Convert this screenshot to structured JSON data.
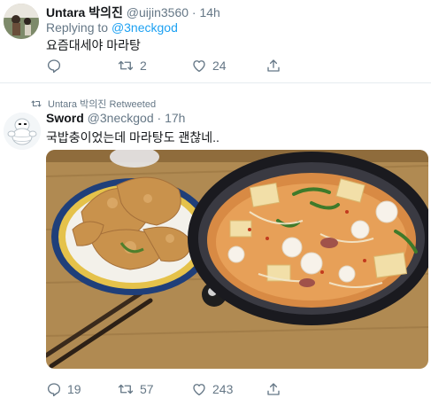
{
  "tweet1": {
    "display_name": "Untara 박의진",
    "handle": "@uijin3560",
    "separator": "·",
    "time": "14h",
    "replying_prefix": "Replying to",
    "replying_to": "@3neckgod",
    "text": "요즘대세야 마라탕",
    "reply_count": "",
    "retweet_count": "2",
    "like_count": "24"
  },
  "retweet_context": {
    "label": "Untara 박의진 Retweeted"
  },
  "tweet2": {
    "display_name": "Sword",
    "handle": "@3neckgod",
    "separator": "·",
    "time": "17h",
    "text": "국밥충이었는데 마라탕도 괜찮네..",
    "reply_count": "19",
    "retweet_count": "57",
    "like_count": "243"
  },
  "colors": {
    "accent": "#1da1f2",
    "muted": "#657786",
    "divider": "#e6ecf0"
  },
  "icons": [
    "reply-icon",
    "retweet-icon",
    "like-icon",
    "share-icon",
    "retweet-context-icon"
  ]
}
